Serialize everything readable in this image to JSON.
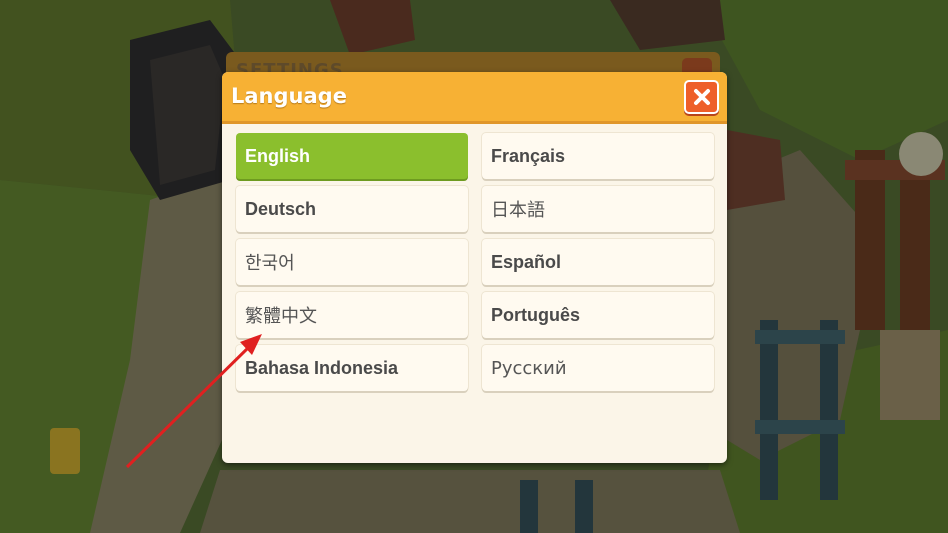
{
  "background": {
    "settings_title": "SETTINGS"
  },
  "dialog": {
    "title": "Language",
    "close_icon": "close-icon",
    "accent_color": "#f7b134",
    "selected_color": "#8bbf2d",
    "close_color": "#ee5f29"
  },
  "languages": [
    {
      "label": "English",
      "selected": true
    },
    {
      "label": "Français",
      "selected": false
    },
    {
      "label": "Deutsch",
      "selected": false
    },
    {
      "label": "日本語",
      "selected": false
    },
    {
      "label": "한국어",
      "selected": false
    },
    {
      "label": "Español",
      "selected": false
    },
    {
      "label": "繁體中文",
      "selected": false
    },
    {
      "label": "Português",
      "selected": false
    },
    {
      "label": "Bahasa Indonesia",
      "selected": false
    },
    {
      "label": "Русский",
      "selected": false
    }
  ],
  "annotation": {
    "arrow_color": "#e02020"
  }
}
